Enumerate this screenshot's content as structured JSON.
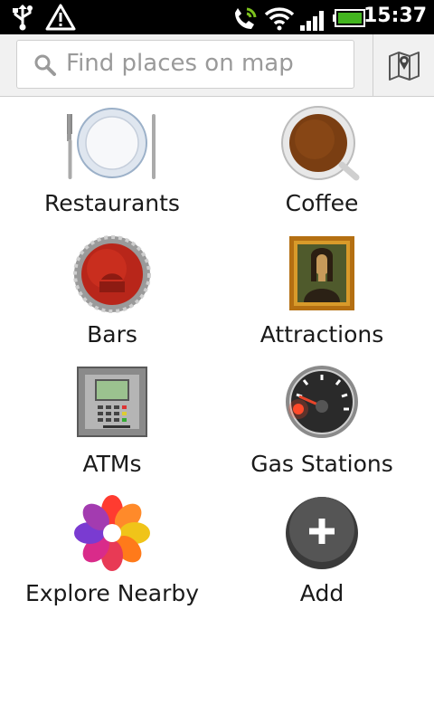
{
  "status_bar": {
    "time": "15:37"
  },
  "search": {
    "placeholder": "Find places on map"
  },
  "categories": [
    {
      "label": "Restaurants",
      "icon": "restaurant-plate-icon"
    },
    {
      "label": "Coffee",
      "icon": "coffee-cup-icon"
    },
    {
      "label": "Bars",
      "icon": "bottle-cap-icon"
    },
    {
      "label": "Attractions",
      "icon": "mona-lisa-painting-icon"
    },
    {
      "label": "ATMs",
      "icon": "atm-machine-icon"
    },
    {
      "label": "Gas Stations",
      "icon": "fuel-gauge-icon"
    },
    {
      "label": "Explore Nearby",
      "icon": "flower-petals-icon"
    },
    {
      "label": "Add",
      "icon": "add-plus-icon"
    }
  ]
}
